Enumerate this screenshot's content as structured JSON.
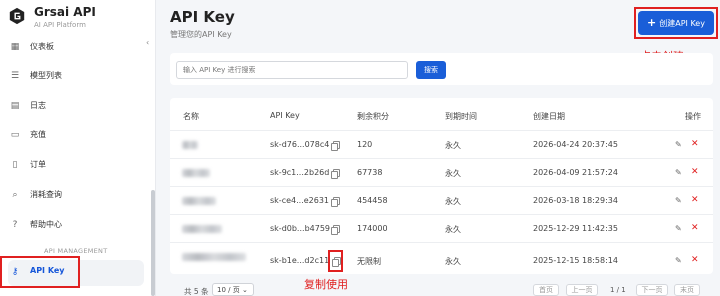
{
  "brand": {
    "title": "Grsai API",
    "subtitle": "AI API Platform"
  },
  "sidebar": {
    "collapse_glyph": "‹",
    "items": [
      {
        "label": "仪表板",
        "icon": "dashboard-icon",
        "glyph": "▦"
      },
      {
        "label": "模型列表",
        "icon": "list-icon",
        "glyph": "☰"
      },
      {
        "label": "日志",
        "icon": "log-icon",
        "glyph": "▤"
      },
      {
        "label": "充值",
        "icon": "card-icon",
        "glyph": "▭"
      },
      {
        "label": "订单",
        "icon": "order-icon",
        "glyph": "▯"
      },
      {
        "label": "消耗查询",
        "icon": "search-icon",
        "glyph": "⌕"
      },
      {
        "label": "帮助中心",
        "icon": "help-icon",
        "glyph": "?"
      }
    ],
    "section_label": "API MANAGEMENT",
    "active_item": {
      "label": "API Key",
      "icon": "key-icon",
      "glyph": "⚷"
    }
  },
  "header": {
    "title": "API Key",
    "subtitle": "管理您的API Key",
    "create_label": "创建API Key",
    "create_glyph": "+",
    "create_annotation": "点击创建"
  },
  "search": {
    "placeholder": "输入 API Key 进行搜索",
    "button_label": "搜索"
  },
  "table": {
    "columns": [
      "名称",
      "API Key",
      "剩余积分",
      "到期时间",
      "创建日期",
      "操作"
    ],
    "rows": [
      {
        "key": "sk-d76...078c4",
        "credits": "120",
        "expiry": "永久",
        "created": "2026-04-24 20:37:45"
      },
      {
        "key": "sk-9c1...2b26d",
        "credits": "67738",
        "expiry": "永久",
        "created": "2026-04-09 21:57:24"
      },
      {
        "key": "sk-ce4...e2631",
        "credits": "454458",
        "expiry": "永久",
        "created": "2026-03-18 18:29:34"
      },
      {
        "key": "sk-d0b...b4759",
        "credits": "174000",
        "expiry": "永久",
        "created": "2025-12-29 11:42:35"
      },
      {
        "key": "sk-b1e...d2c11",
        "credits": "无限制",
        "expiry": "永久",
        "created": "2025-12-15 18:58:14"
      }
    ],
    "edit_glyph": "✎",
    "delete_glyph": "✕",
    "copy_annotation": "复制使用"
  },
  "pagination": {
    "total": "共 5 条",
    "page_size": "10 / 页",
    "first": "首页",
    "prev": "上一页",
    "page_info": "1 / 1",
    "next": "下一页",
    "last": "末页"
  },
  "colors": {
    "accent": "#1a5ed8",
    "annotation": "#e02020"
  }
}
